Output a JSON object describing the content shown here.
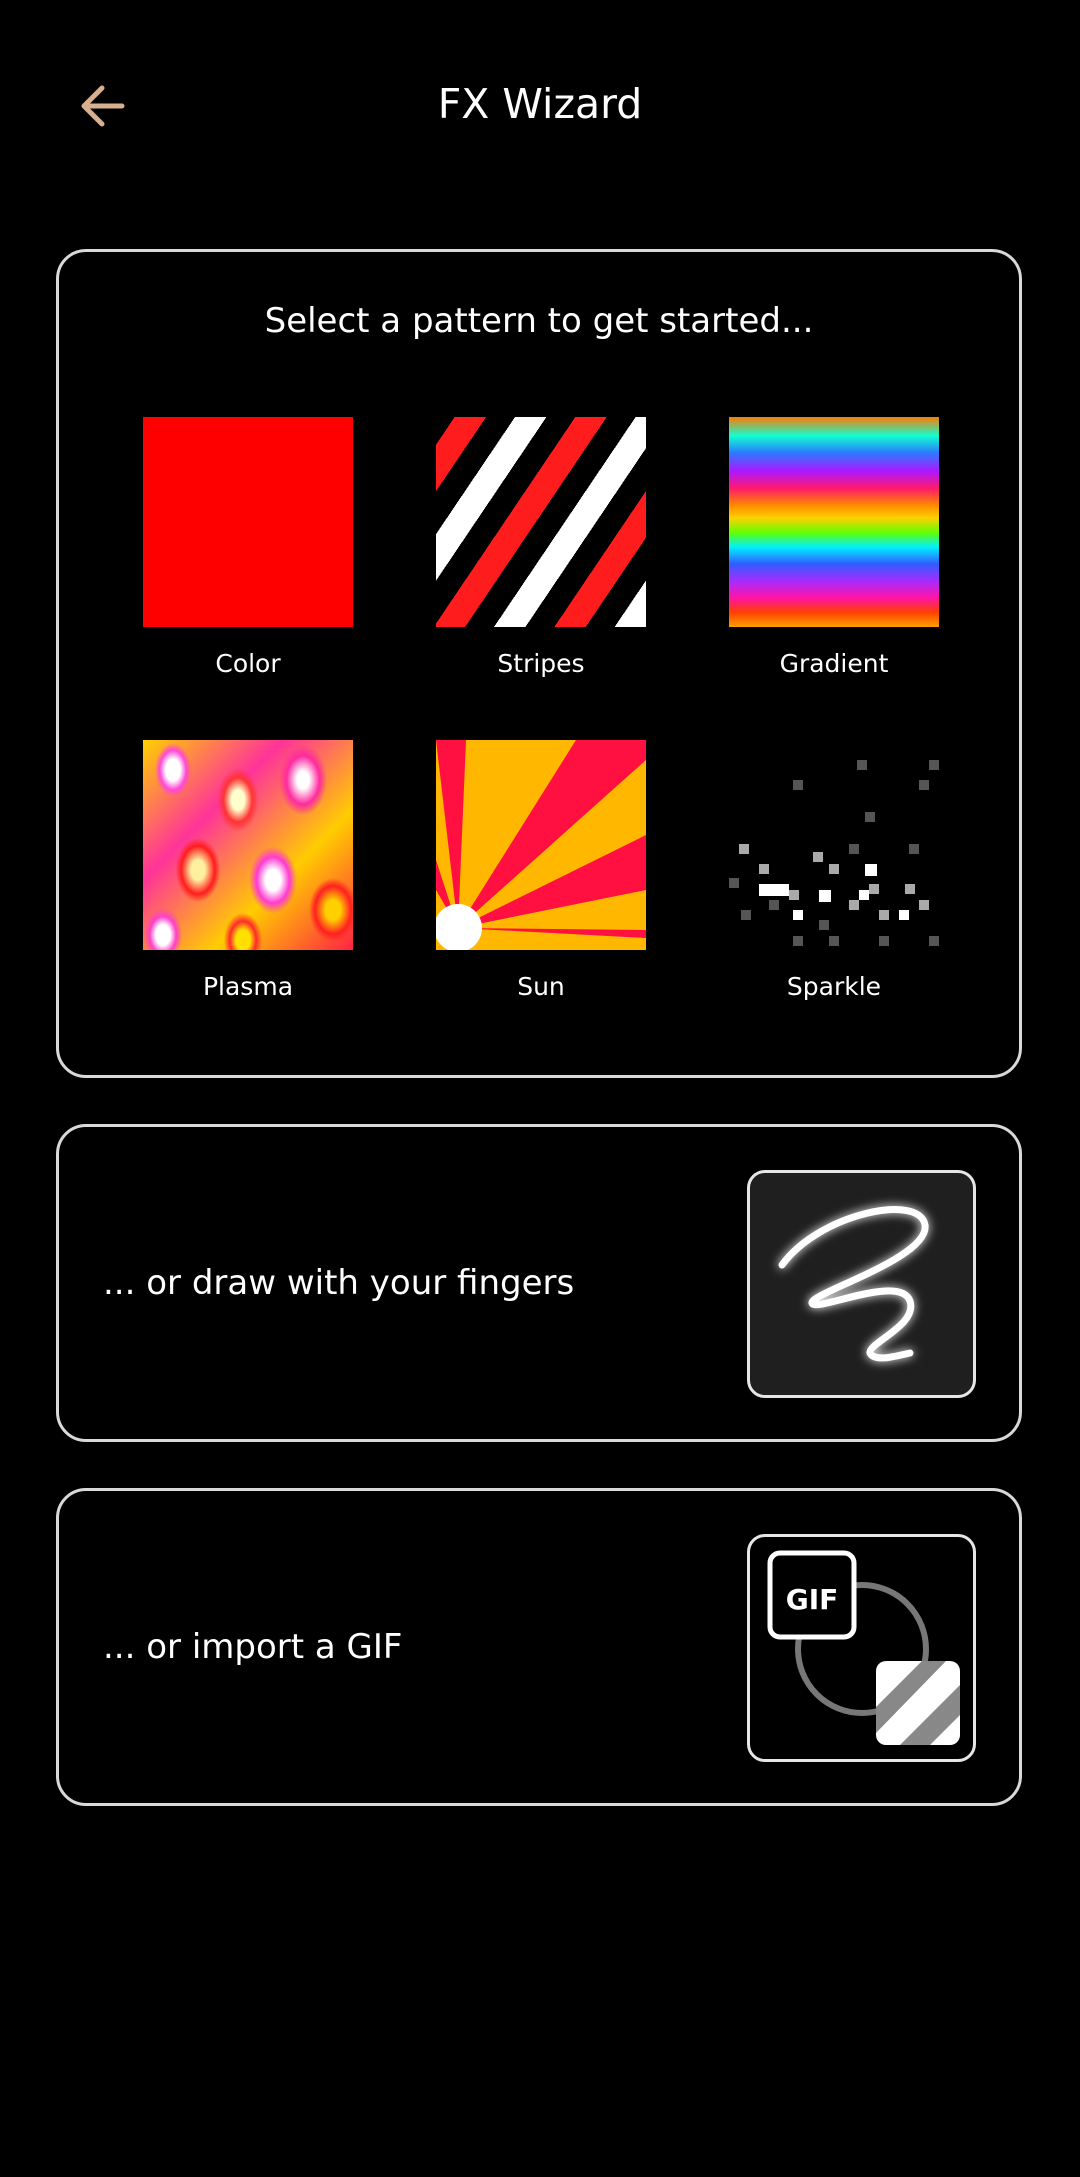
{
  "header": {
    "title": "FX Wizard",
    "back_icon": "arrow-left-icon",
    "accent_color": "#d9b08f"
  },
  "patterns_card": {
    "heading": "Select a pattern to get started...",
    "patterns": [
      {
        "label": "Color"
      },
      {
        "label": "Stripes"
      },
      {
        "label": "Gradient"
      },
      {
        "label": "Plasma"
      },
      {
        "label": "Sun"
      },
      {
        "label": "Sparkle"
      }
    ]
  },
  "draw_card": {
    "label": "... or draw with your fingers",
    "icon": "squiggle-draw-icon"
  },
  "gif_card": {
    "label": "... or import a GIF",
    "icon": "gif-import-icon",
    "badge": "GIF"
  }
}
